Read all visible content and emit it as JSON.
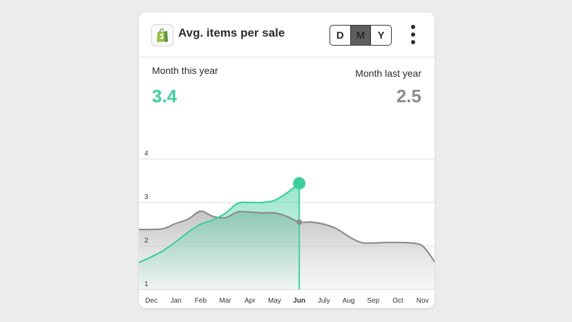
{
  "widget": {
    "title": "Avg. items per sale",
    "icon": "shopify-bag-icon",
    "range_options": [
      "D",
      "M",
      "Y"
    ],
    "selected_range": "M",
    "menu_icon": "more-vertical-icon"
  },
  "summary": {
    "this_label": "Month this year",
    "this_value": "3.4",
    "last_label": "Month last year",
    "last_value": "2.5"
  },
  "colors": {
    "accent": "#3ecf9c",
    "last_year": "#8c8c8c"
  },
  "chart_data": {
    "type": "area",
    "categories": [
      "Dec",
      "Jan",
      "Feb",
      "Mar",
      "Apr",
      "May",
      "Jun",
      "July",
      "Aug",
      "Sep",
      "Oct",
      "Nov"
    ],
    "highlight_category": "Jun",
    "ylim": [
      1,
      4
    ],
    "yticks": [
      1,
      2,
      3,
      4
    ],
    "grid": true,
    "series": [
      {
        "key": "last",
        "x": [
          -0.5,
          0,
          0.5,
          1,
          1.5,
          2,
          2.5,
          3,
          3.5,
          4,
          4.5,
          5,
          5.5,
          6,
          6.5,
          7,
          7.5,
          8,
          8.5,
          9,
          9.5,
          10,
          10.5,
          11,
          11.5
        ],
        "values": [
          2.38,
          2.38,
          2.4,
          2.52,
          2.62,
          2.8,
          2.68,
          2.65,
          2.78,
          2.78,
          2.76,
          2.76,
          2.68,
          2.55,
          2.55,
          2.5,
          2.4,
          2.22,
          2.08,
          2.07,
          2.08,
          2.08,
          2.07,
          2.0,
          1.63
        ]
      },
      {
        "key": "this",
        "x": [
          -0.5,
          0,
          0.5,
          1,
          1.5,
          2,
          2.5,
          3,
          3.5,
          4,
          4.5,
          5,
          5.5,
          6
        ],
        "values": [
          1.62,
          1.75,
          1.9,
          2.1,
          2.32,
          2.5,
          2.6,
          2.75,
          2.98,
          3.0,
          3.0,
          3.05,
          3.22,
          3.44
        ]
      }
    ]
  }
}
